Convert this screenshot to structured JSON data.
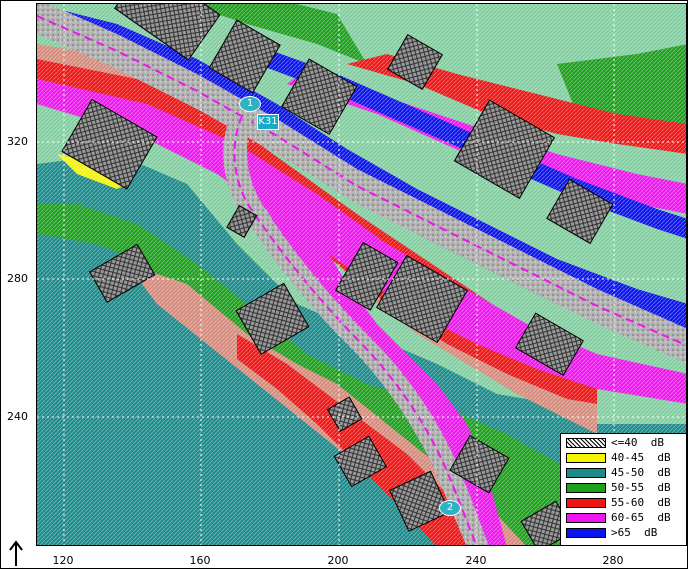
{
  "map": {
    "x_axis_ticks": [
      "120",
      "160",
      "200",
      "240",
      "280"
    ],
    "y_axis_ticks": [
      "320",
      "280",
      "240"
    ],
    "road_label": "K31",
    "points": [
      {
        "label": "1"
      },
      {
        "label": "2"
      }
    ],
    "colors": {
      "le40": "#8a8a8a",
      "40_45": "#f5f500",
      "45_50": "#1a8a8a",
      "50_55": "#1ca01c",
      "55_60": "#f01414",
      "60_65": "#f014f0",
      "gt65": "#0a14f0",
      "road": "#a8a8a8",
      "light_green": "#7fcf9e",
      "salmon": "#d88a7a"
    }
  },
  "legend": {
    "items": [
      {
        "label": "<=40  dB",
        "color": "#8a8a8a"
      },
      {
        "label": "40-45  dB",
        "color": "#f5f500"
      },
      {
        "label": "45-50  dB",
        "color": "#1a8a8a"
      },
      {
        "label": "50-55  dB",
        "color": "#1ca01c"
      },
      {
        "label": "55-60  dB",
        "color": "#f01414"
      },
      {
        "label": "60-65  dB",
        "color": "#f014f0"
      },
      {
        "label": ">65  dB",
        "color": "#0a14f0"
      }
    ]
  }
}
